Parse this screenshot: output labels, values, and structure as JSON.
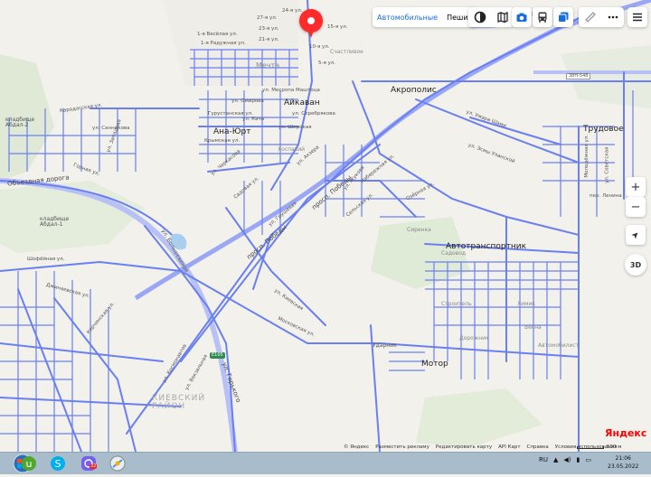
{
  "colors": {
    "road": "#6a7ff2",
    "road_dark": "#5366e0",
    "bg": "#f2f1ec",
    "green": "#d8e8cf",
    "highway": "#9aa7f5",
    "pin": "#ff2a2a"
  },
  "map": {
    "districts": {
      "akropolis": "Акрополис",
      "aikavan": "Айкаван",
      "ana_yurt": "Ана-Юрт",
      "trudovoe": "Трудовое",
      "avtotransportnik": "Автотранспортник",
      "motor": "Мотор",
      "kievsky": "КИЕВСКИЙ\nРАЙОН",
      "mechta": "Мечта",
      "khoshaevi": "Хоспавий",
      "shchastlive": "Счастливое",
      "sirenka": "Сиренка",
      "sadovod": "Садовод",
      "stroitel": "Строитель",
      "udarnik": "Ударник",
      "dorozhnik": "Дорожник",
      "khimik": "Химик",
      "vesna": "Весна",
      "avtomobilist": "Автомобилист"
    },
    "cemeteries": {
      "abdal2": "кладбище\nАбдал-2",
      "abdal1": "кладбище\nАбдал-1"
    },
    "roads": {
      "obezdnaya": "Объездная дорога",
      "prosp_pobedy": "просп. Победы",
      "ul_bolshevikov": "ул. Большевиков",
      "ul_gorkogo": "ул. Горького",
      "prosp_pobedy2": "просп. Победы",
      "e105": "E105",
      "ul_karadagskaya": "Карадагская ул.",
      "ul_sannikov": "ул. Санникова",
      "ul_mesrop": "ул. Месропа Маштоца",
      "ul_serebryakova": "ул. Серебрякова",
      "ul_kacha": "ул. Кача",
      "ul_omirova": "ул. Омирова",
      "ul_gurustanskaya": "Гурустанская ул.",
      "ul_krymskaya": "Крымская ул.",
      "ul_shirokaya": "ул. Широкая",
      "ul_cherkasova": "ул. Черкасова",
      "ul_vesyolaya": "1-я Весёлая ул.",
      "ul_raduzhnaya": "1-я Радужная ул.",
      "ul_27": "27-я ул.",
      "ul_24": "24-я ул.",
      "ul_23": "23-я ул.",
      "ul_21": "21-я ул.",
      "ul_15": "15-я ул.",
      "ul_10": "10-я ул.",
      "ul_5": "5-я ул.",
      "ul_umara": "ул. Умара Шами",
      "ul_esmy": "ул. Эсмы Уланской",
      "ul_zhukova": "ул. Жукова",
      "ul_akhzera": "ул. Ахзера",
      "ul_selskaya": "Сельская ул.",
      "ul_gruzovaya": "ул. Грушевая",
      "ul_sadovaya": "Садовая ул.",
      "ul_ozernaya": "Озёрная ул.",
      "ul_shofeinaya": "Шофёйная ул.",
      "ul_gornaya": "Горная ул.",
      "ul_zapadnaya": "ул. Западная",
      "ul_dzhinovskaya": "Джинаевская ул.",
      "ul_kievskaya": "ул. Киевская",
      "ul_moskovskaya": "Московская ул.",
      "ul_kosmonavtov": "ул. Космонавтов",
      "ul_kerchenskaya": "Керченская ул.",
      "ul_lenina": "пер. Ленина",
      "ul_vokzalnaya": "ул. Вокзальная",
      "road_38n": "38Н-548",
      "ul_molodyozhnaya": "Молодёжная ул.",
      "ul_sovetskaya": "ул. Советская",
      "ul_naberezhnaya": "Набережная ул."
    }
  },
  "toolbar": {
    "route_car": "Автомобильные",
    "route_walk": "Пешие"
  },
  "controls": {
    "zoom_in": "+",
    "zoom_out": "−",
    "locate": "➤",
    "view3d": "3D"
  },
  "footer": {
    "brand": "Яндекс",
    "copyright": "© Яндекс",
    "advertise": "Разместить рекламу",
    "transport_map": "Редактировать карту",
    "api": "API Карт",
    "help": "Справка",
    "terms": "Условия использования",
    "scale": "500 м"
  },
  "taskbar": {
    "lang": "RU",
    "time": "21:06",
    "date": "23.05.2022",
    "viber_badge": "32"
  }
}
